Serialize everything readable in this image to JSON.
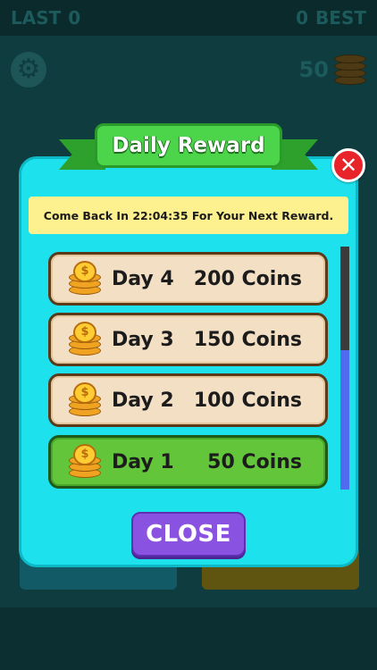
{
  "hud": {
    "last_label": "LAST",
    "last_value": "0",
    "best_value": "0",
    "best_label": "BEST",
    "coin_count": "50"
  },
  "modal": {
    "title": "Daily Reward",
    "message": "Come Back In 22:04:35 For Your Next Reward.",
    "close_label": "CLOSE",
    "rewards": [
      {
        "day": "Day 4",
        "amount": "200 Coins",
        "state": "locked"
      },
      {
        "day": "Day 3",
        "amount": "150 Coins",
        "state": "locked"
      },
      {
        "day": "Day 2",
        "amount": "100 Coins",
        "state": "locked"
      },
      {
        "day": "Day 1",
        "amount": "50 Coins",
        "state": "claimed"
      }
    ]
  },
  "icons": {
    "settings": "gear-icon",
    "coins": "coin-stack-icon",
    "close": "close-x-icon"
  },
  "colors": {
    "modal_bg": "#1de2ee",
    "ribbon": "#4cd44a",
    "banner": "#fdf08e",
    "row_locked": "#f3dfc4",
    "row_active": "#62c53a",
    "close_button": "#8a52e0",
    "close_x": "#e8232a"
  }
}
